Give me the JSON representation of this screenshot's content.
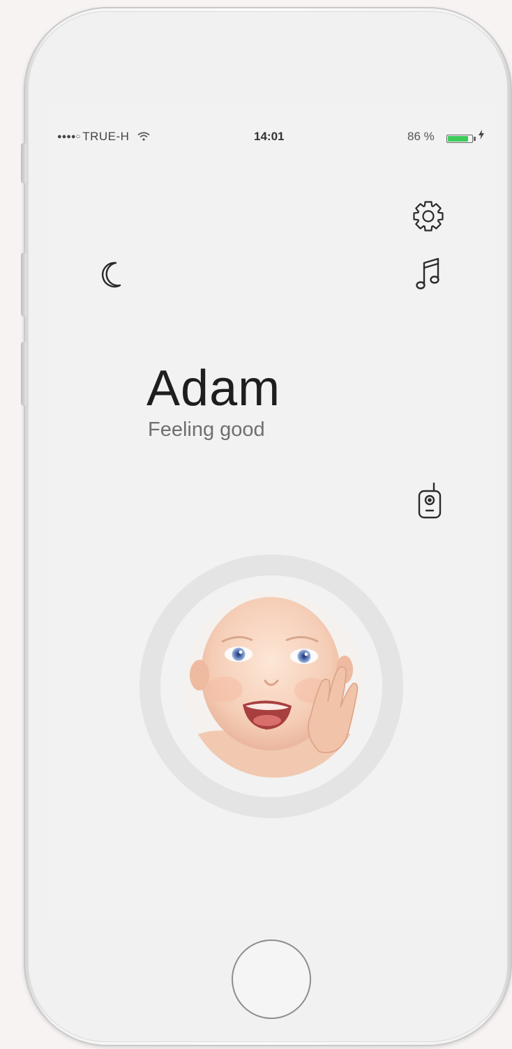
{
  "status_bar": {
    "signal": "●●●●○",
    "carrier": "TRUE-H",
    "time": "14:01",
    "battery_percent": "86 %",
    "battery_level": 0.86,
    "battery_color": "#3dcc5a"
  },
  "icons": {
    "settings": "gear-icon",
    "music": "music-note-icon",
    "night_mode": "moon-icon",
    "baby_monitor": "baby-monitor-icon"
  },
  "profile": {
    "name": "Adam",
    "status": "Feeling good"
  }
}
